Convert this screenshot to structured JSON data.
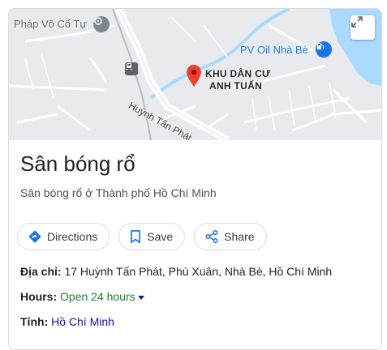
{
  "map": {
    "labels": {
      "poi_temple": "Pháp Võ Cổ Tự",
      "poi_gas": "PV Oil Nhà Bè",
      "area_line1": "KHU DÂN CƯ",
      "area_line2": "ANH TUẤN",
      "street": "Huỳnh Tấn Phát"
    },
    "icons": [
      "temple-icon",
      "gas-station-icon",
      "train-station-icon",
      "map-pin-icon",
      "expand-icon"
    ]
  },
  "place": {
    "title": "Sân bóng rổ",
    "subtitle": "Sân bóng rổ ở Thành phố Hồ Chí Minh"
  },
  "actions": {
    "directions": "Directions",
    "save": "Save",
    "share": "Share"
  },
  "details": {
    "address_label": "Địa chỉ:",
    "address_value": "17 Huỳnh Tấn Phát, Phú Xuân, Nhà Bè, Hồ Chí Minh",
    "hours_label": "Hours:",
    "hours_value": "Open 24 hours",
    "province_label": "Tỉnh:",
    "province_value": "Hồ Chí Minh"
  },
  "colors": {
    "accent": "#1a73e8",
    "water": "#aadaff",
    "pin": "#ea4335",
    "open": "#188038",
    "link": "#1a0dab"
  }
}
